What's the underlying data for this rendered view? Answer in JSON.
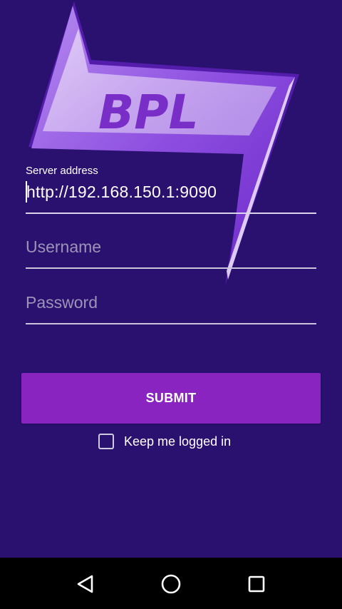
{
  "logo": {
    "text": "BPL"
  },
  "form": {
    "server": {
      "label": "Server address",
      "value": "http://192.168.150.1:9090"
    },
    "username": {
      "placeholder": "Username",
      "value": ""
    },
    "password": {
      "placeholder": "Password",
      "value": ""
    },
    "submit_label": "SUBMIT",
    "keep_logged_in": {
      "label": "Keep me logged in",
      "checked": false
    }
  },
  "colors": {
    "background": "#2a1170",
    "accent": "#8a24c0",
    "logo_light": "#c9a8ee",
    "logo_mid": "#9a5fe0",
    "logo_text": "#7a2ec8"
  },
  "navbar": {
    "back_icon": "back-triangle-icon",
    "home_icon": "home-circle-icon",
    "recents_icon": "recents-square-icon"
  }
}
